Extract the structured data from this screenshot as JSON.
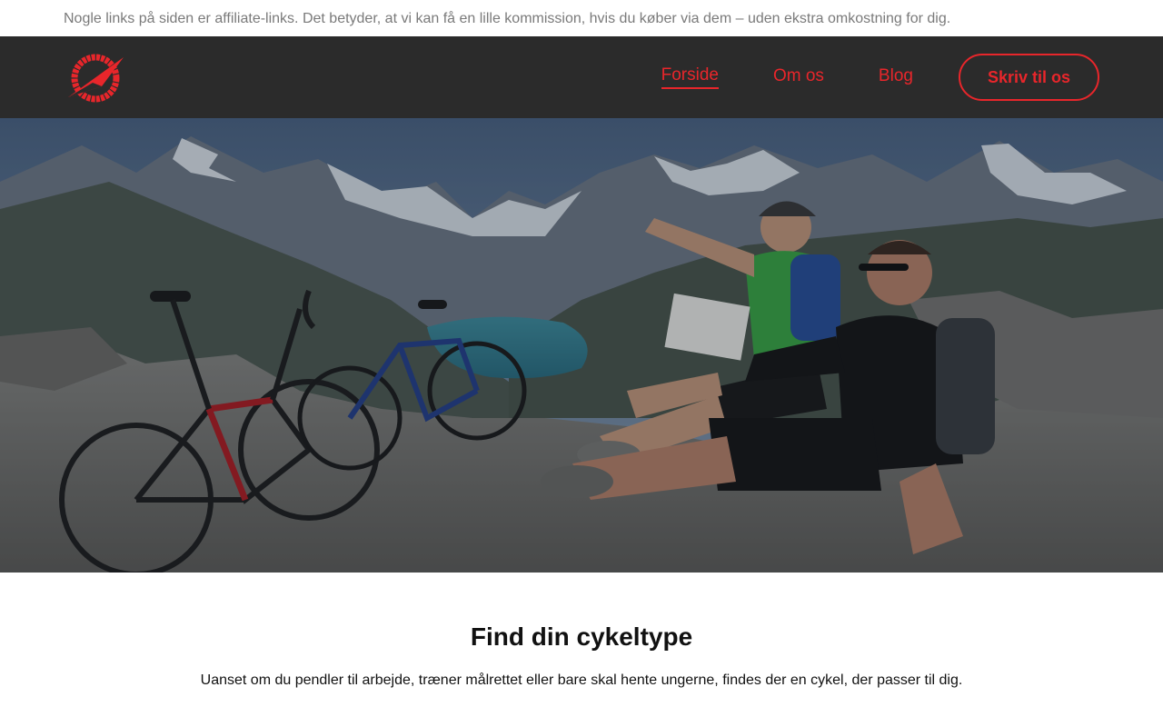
{
  "disclaimer": {
    "text": "Nogle links på siden er affiliate-links. Det betyder, at vi kan få en lille kommission, hvis du køber via dem – uden ekstra omkostning for dig."
  },
  "header": {
    "logo_icon": "bicycle-wheel-compass-logo",
    "nav": [
      {
        "label": "Forside",
        "active": true
      },
      {
        "label": "Om os",
        "active": false
      },
      {
        "label": "Blog",
        "active": false
      }
    ],
    "cta_label": "Skriv til os"
  },
  "hero": {
    "image_subject": "two-cyclists-resting-on-mountain-above-lake"
  },
  "section": {
    "title": "Find din cykeltype",
    "text": "Uanset om du pendler til arbejde, træner målrettet eller bare skal hente ungerne, findes der en cykel, der passer til dig."
  },
  "colors": {
    "accent": "#e8262b",
    "header_bg": "#2b2b2b",
    "muted_text": "#7a7a7a"
  }
}
